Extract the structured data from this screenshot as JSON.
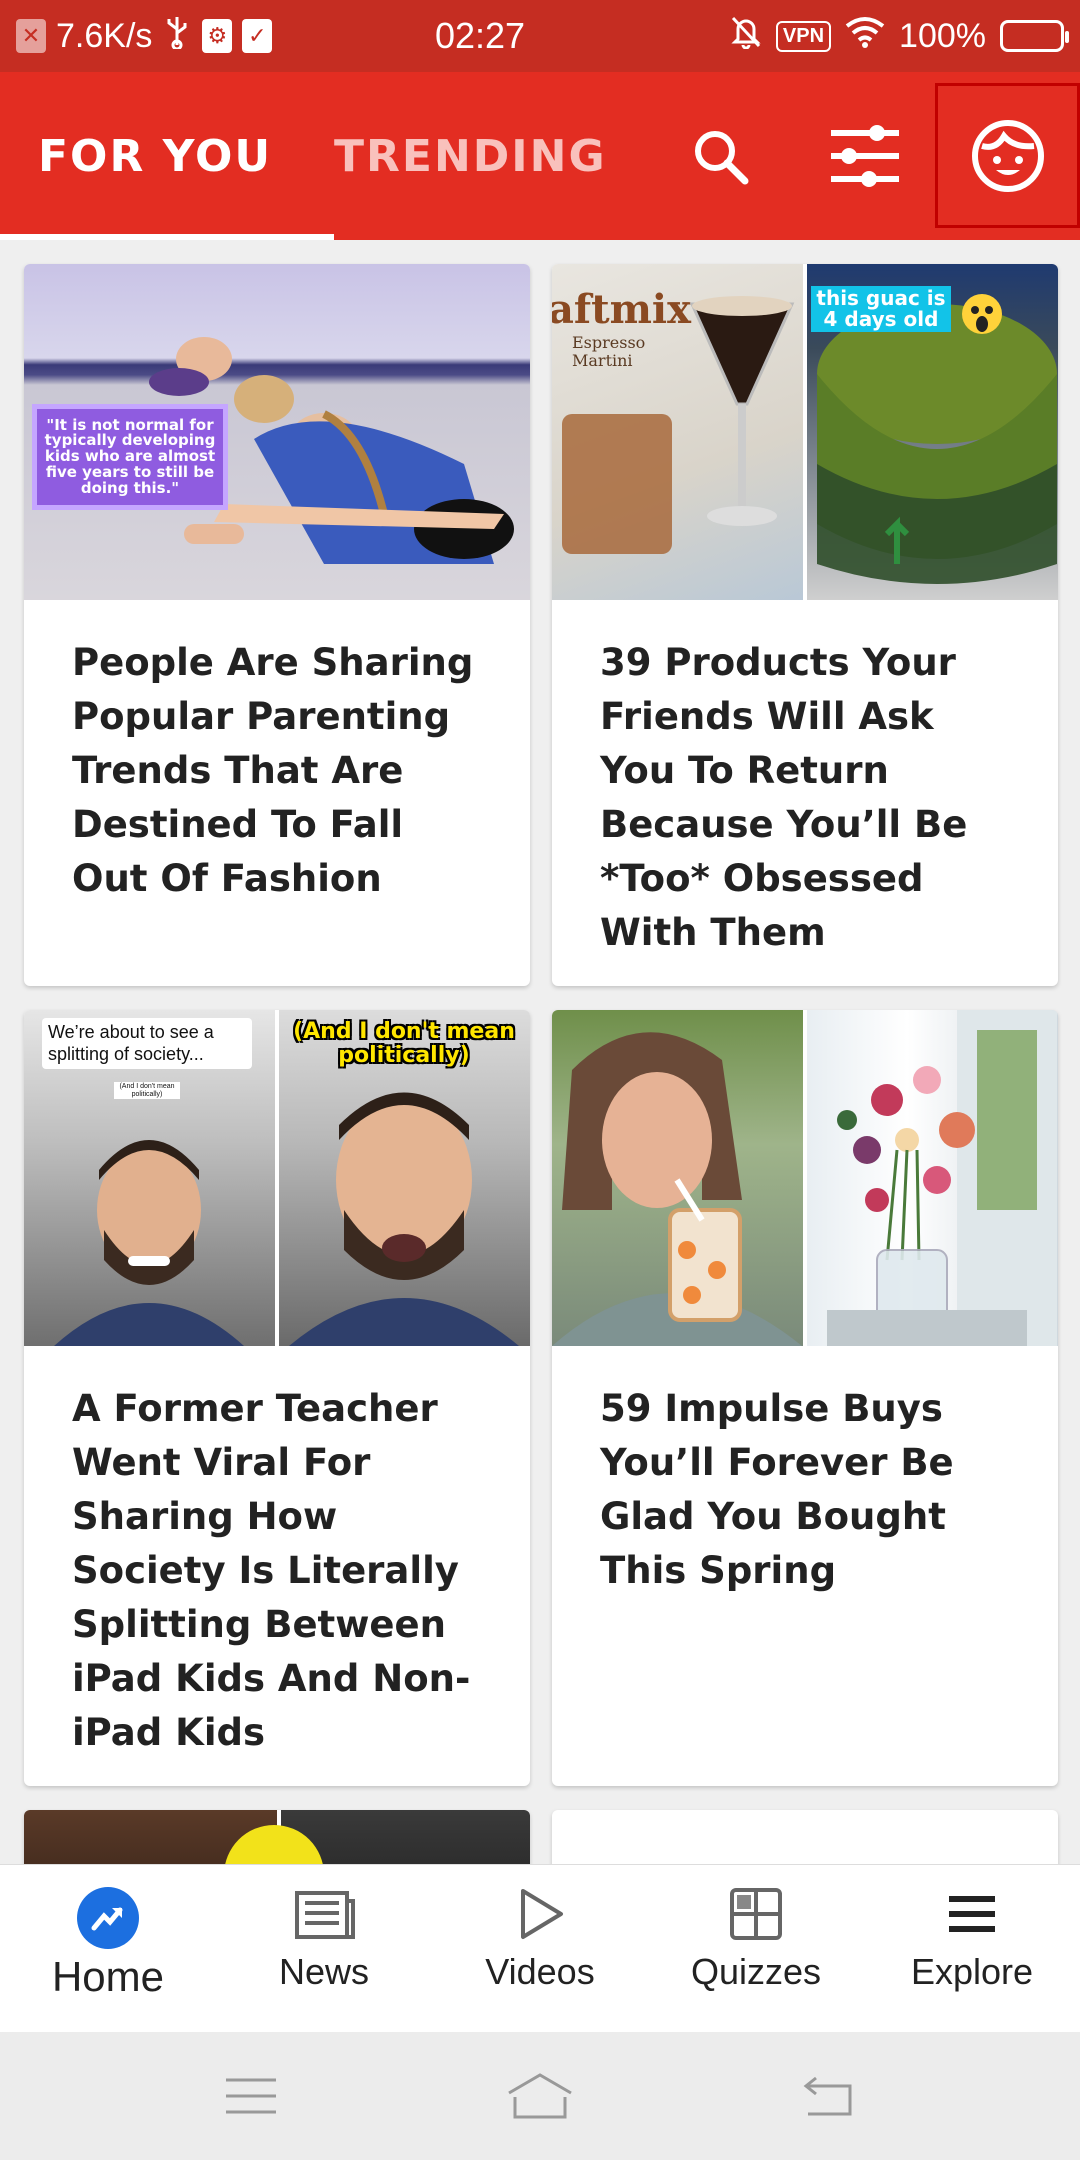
{
  "status_bar": {
    "speed": "7.6K/s",
    "time": "02:27",
    "vpn": "VPN",
    "battery": "100%",
    "battery_level": 1.0
  },
  "header": {
    "tabs": [
      {
        "label": "FOR YOU",
        "active": true
      },
      {
        "label": "TRENDING",
        "active": false
      }
    ],
    "icons": [
      "search-icon",
      "filter-sliders-icon",
      "profile-face-icon"
    ]
  },
  "feed": {
    "cards": [
      {
        "title": "People Are Sharing Popular Parenting Trends That Are Destined To Fall Out Of Fashion",
        "image_caption": "\"It is not normal for typically developing kids who are almost five years to still be doing this.\""
      },
      {
        "title": "39 Products Your Friends Will Ask You To Return Because You’ll Be *Too* Obsessed With Them",
        "image_brand": "aftmix",
        "image_label": "Espresso Martini",
        "image_caption": "this guac is 4 days old"
      },
      {
        "title": "A Former Teacher Went Viral For Sharing How Society Is Literally Splitting Between iPad Kids And Non-iPad Kids",
        "image_caption_left": "We’re about to see a splitting of society...",
        "image_subcaption_left": "(And I don't mean politically)",
        "image_caption_right": "(And I don't mean politically)"
      },
      {
        "title": "59 Impulse Buys You’ll Forever Be Glad You Bought This Spring"
      }
    ]
  },
  "bottom_nav": {
    "items": [
      {
        "label": "Home",
        "icon": "trending-arrow-icon",
        "active": true
      },
      {
        "label": "News",
        "icon": "newspaper-icon",
        "active": false
      },
      {
        "label": "Videos",
        "icon": "play-icon",
        "active": false
      },
      {
        "label": "Quizzes",
        "icon": "grid-icon",
        "active": false
      },
      {
        "label": "Explore",
        "icon": "menu-icon",
        "active": false
      }
    ]
  },
  "colors": {
    "brand_red": "#e32d22",
    "status_red": "#c52d22",
    "home_blue": "#1c6fe0"
  }
}
